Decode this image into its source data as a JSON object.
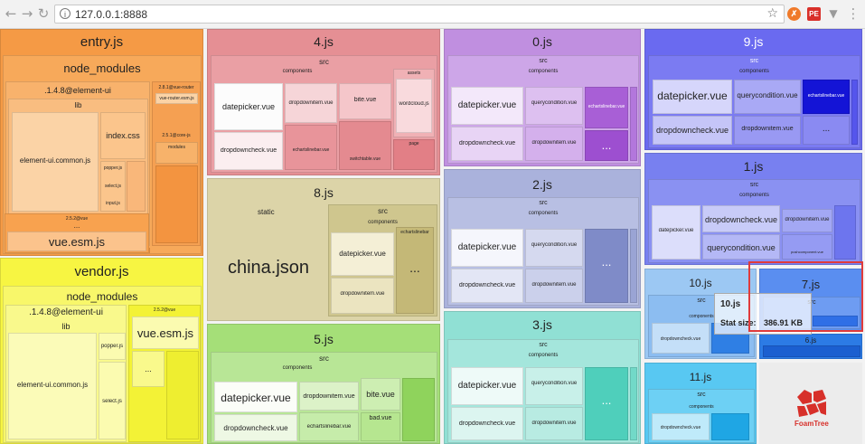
{
  "browser": {
    "url": "127.0.0.1:8888",
    "ext1_label": "✗",
    "ext2_label": "PE"
  },
  "treemap": {
    "entry": {
      "title": "entry.js",
      "node_modules": "node_modules",
      "element": ".1.4.8@element-ui",
      "lib": "lib",
      "index_css": "index.css",
      "common": "element-ui.common.js",
      "popper": "popper.js",
      "select": "select.js",
      "input": "input.js",
      "vue_pkg": "2.5.2@vue",
      "vue_esm": "vue.esm.js",
      "vr_pkg": "2.8.1@vue-router",
      "vr_file": "vue-router.esm.js",
      "corejs": "2.5.1@core-js",
      "modules": "modules",
      "more": "..."
    },
    "vendor": {
      "title": "vendor.js",
      "node_modules": "node_modules",
      "element": ".1.4.8@element-ui",
      "lib": "lib",
      "common": "element-ui.common.js",
      "popper": "popper.js",
      "select": "select.js",
      "vue_pkg": "2.5.2@vue",
      "vue_esm": "vue.esm.js",
      "more": "..."
    },
    "c4": {
      "title": "4.js",
      "src": "src",
      "components": "components",
      "datepicker": "datepicker.vue",
      "dropdowncheck": "dropdowncheck.vue",
      "dropdownitem": "dropdownitem.vue",
      "echarts": "echartslinebar.vue",
      "bite": "bite.vue",
      "switch": "switchtable.vue",
      "assets": "assets",
      "wordcloud": "wordcloud.js",
      "page": "page",
      "more": "..."
    },
    "c8": {
      "title": "8.js",
      "static": "static",
      "src": "src",
      "components": "components",
      "china": "china.json",
      "datepicker": "datepicker.vue",
      "dropdownitem": "dropdownitem.vue",
      "echarts": "echartslinebar",
      "more": "..."
    },
    "c5": {
      "title": "5.js",
      "src": "src",
      "components": "components",
      "datepicker": "datepicker.vue",
      "dropdowncheck": "dropdowncheck.vue",
      "dropdownitem": "dropdownitem.vue",
      "echarts": "echartslinebar.vue",
      "bite": "bite.vue",
      "bad": "bad.vue",
      "more": "..."
    },
    "c0": {
      "title": "0.js",
      "src": "src",
      "components": "components",
      "datepicker": "datepicker.vue",
      "querycondition": "querycondition.vue",
      "dropdowncheck": "dropdowncheck.vue",
      "dropdownitem": "dropdownitem.vue",
      "echarts": "echartslinebar.vue",
      "more": "..."
    },
    "c2": {
      "title": "2.js",
      "src": "src",
      "components": "components",
      "datepicker": "datepicker.vue",
      "querycondition": "querycondition.vue",
      "dropdowncheck": "dropdowncheck.vue",
      "dropdownitem": "dropdownitem.vue",
      "more": "..."
    },
    "c3": {
      "title": "3.js",
      "src": "src",
      "components": "components",
      "datepicker": "datepicker.vue",
      "querycondition": "querycondition.vue",
      "dropdowncheck": "dropdowncheck.vue",
      "dropdownitem": "dropdownitem.vue",
      "more": "..."
    },
    "c9": {
      "title": "9.js",
      "src": "src",
      "components": "components",
      "datepicker": "datepicker.vue",
      "querycondition": "querycondition.vue",
      "dropdowncheck": "dropdowncheck.vue",
      "dropdownitem": "dropdownitem.vue",
      "echarts": "echartslinebar.vue",
      "more": "..."
    },
    "c1": {
      "title": "1.js",
      "src": "src",
      "components": "components",
      "datepicker": "datepicker.vue",
      "dropdowncheck": "dropdowncheck.vue",
      "querycondition": "querycondition.vue",
      "dropdownitem": "dropdownitem.vue",
      "pushcomponent": "pushcomponent.vue",
      "more": "..."
    },
    "c10": {
      "title": "10.js",
      "src": "src",
      "components": "components",
      "dropdowncheck": "dropdowncheck.vue"
    },
    "c7": {
      "title": "7.js",
      "src": "src"
    },
    "c6": {
      "title": "6.js"
    },
    "c11": {
      "title": "11.js",
      "src": "src",
      "components": "components",
      "dropdowncheck": "dropdowncheck.vue"
    },
    "tooltip": {
      "name": "10.js",
      "stat_label": "Stat size:",
      "stat_value": "386.91 KB"
    },
    "foamtree": {
      "label": "FoamTree"
    }
  },
  "colors": {
    "entry": "#f59a45",
    "vendor": "#f7f542",
    "c4": "#e58f94",
    "c8": "#dcd4a8",
    "c5": "#a5df78",
    "c0": "#c08fe0",
    "c2": "#aab2dc",
    "c3": "#90e0d4",
    "c9": "#6a6af0",
    "c1": "#7880f0",
    "c10": "#9cc8f3",
    "c7": "#5a8ef0",
    "c11": "#58c8f2"
  }
}
